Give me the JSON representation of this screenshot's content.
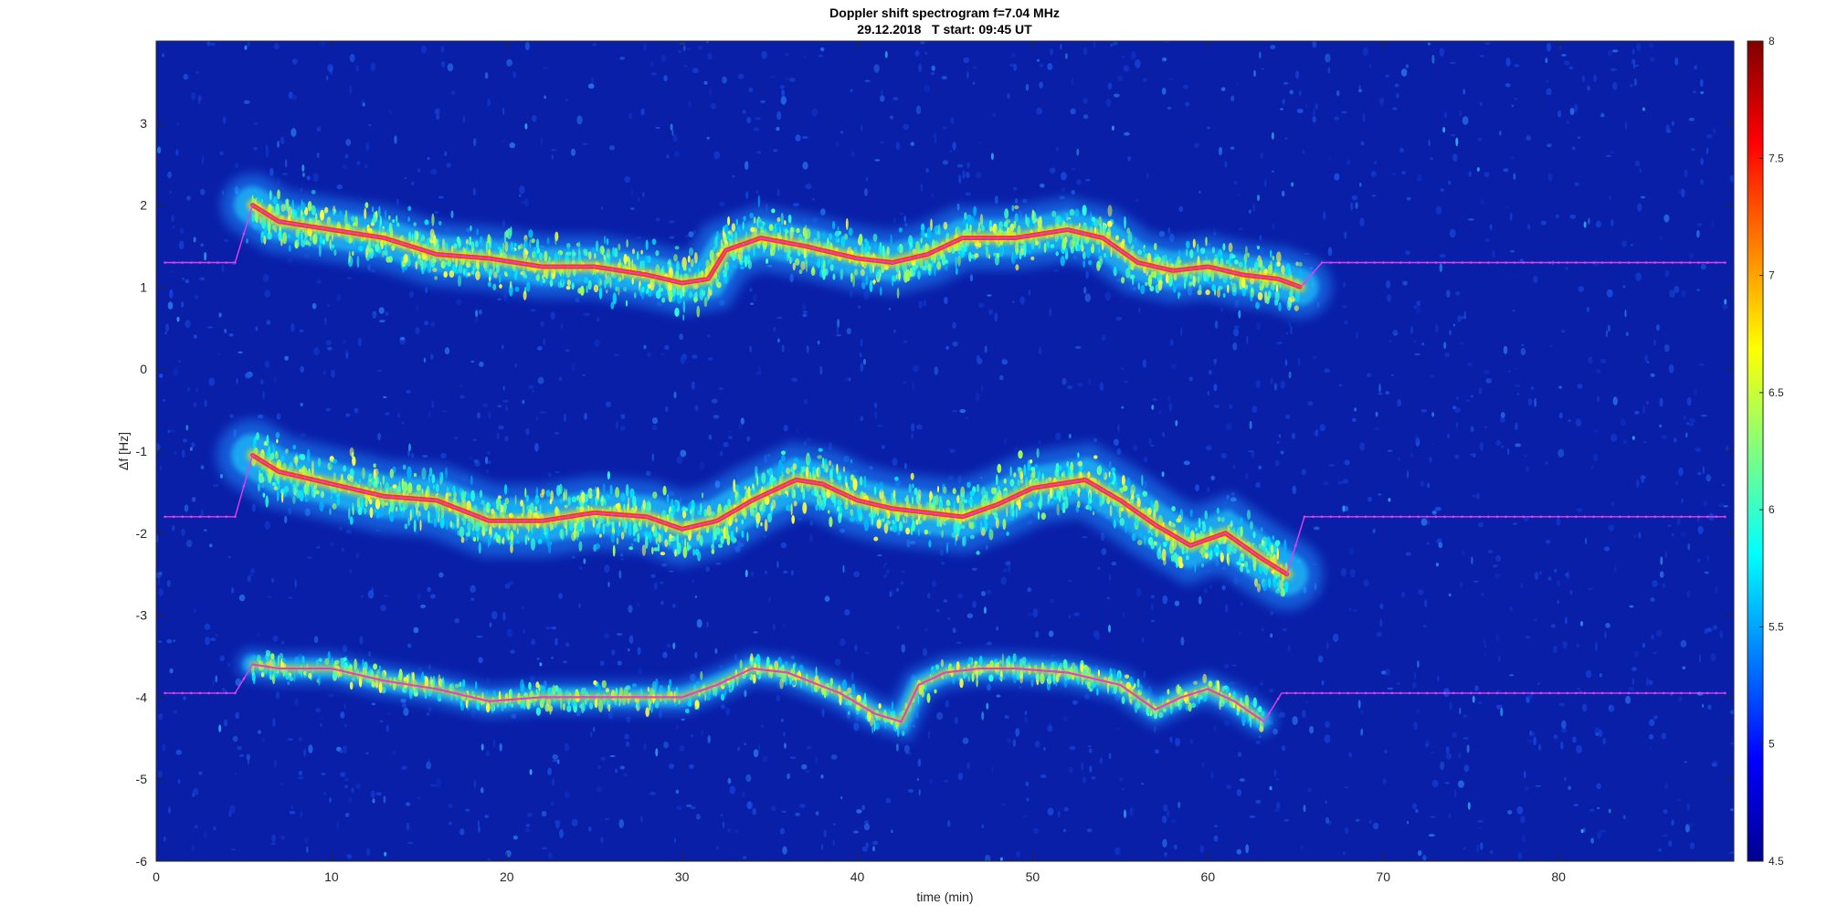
{
  "chart_data": {
    "type": "heatmap",
    "title": "Doppler shift spectrogram f=7.04 MHz",
    "subtitle": "29.12.2018   T start: 09:45 UT",
    "xlabel": "time (min)",
    "ylabel": "Δf [Hz]",
    "xlim": [
      0,
      90
    ],
    "ylim": [
      -6,
      4
    ],
    "x_ticks": [
      0,
      10,
      20,
      30,
      40,
      50,
      60,
      70,
      80
    ],
    "x_tick_labels": [
      "0",
      "10",
      "20",
      "30",
      "40",
      "50",
      "60",
      "70",
      "80"
    ],
    "y_ticks": [
      -6,
      -5,
      -4,
      -3,
      -2,
      -1,
      0,
      1,
      2,
      3
    ],
    "y_tick_labels": [
      "-6",
      "-5",
      "-4",
      "-3",
      "-2",
      "-1",
      "0",
      "1",
      "2",
      "3"
    ],
    "colormap": "jet",
    "colorbar": {
      "range": [
        4.5,
        8
      ],
      "ticks": [
        4.5,
        5,
        5.5,
        6,
        6.5,
        7,
        7.5,
        8
      ],
      "tick_labels": [
        "4.5",
        "5",
        "5.5",
        "6",
        "6.5",
        "7",
        "7.5",
        "8"
      ]
    },
    "background_color": "#0a1fa8",
    "trace_color": "#e040f0",
    "series": [
      {
        "x": [
          0.5,
          4.5,
          5.5,
          7,
          10,
          13,
          16,
          19,
          22,
          25,
          28,
          30,
          31.5,
          32.5,
          34.5,
          37,
          40,
          42,
          44,
          46,
          49,
          52,
          54,
          56,
          58,
          60,
          62,
          64,
          65.3,
          66.5,
          89.5
        ],
        "y": [
          1.3,
          1.3,
          2.0,
          1.8,
          1.7,
          1.6,
          1.4,
          1.35,
          1.25,
          1.25,
          1.15,
          1.05,
          1.1,
          1.45,
          1.6,
          1.5,
          1.35,
          1.3,
          1.4,
          1.6,
          1.6,
          1.7,
          1.6,
          1.3,
          1.2,
          1.25,
          1.15,
          1.1,
          1.0,
          1.3,
          1.3
        ],
        "core_from": 5.5,
        "core_to": 65.3,
        "spread": 0.35
      },
      {
        "x": [
          0.5,
          4.5,
          5.5,
          7,
          10,
          13,
          16,
          19,
          22,
          25,
          28,
          30,
          32,
          34,
          36.5,
          38,
          40,
          42,
          44,
          46,
          48,
          50,
          53,
          55,
          57,
          59,
          61,
          63,
          64.5,
          65.5,
          89.5
        ],
        "y": [
          -1.8,
          -1.8,
          -1.05,
          -1.25,
          -1.4,
          -1.55,
          -1.6,
          -1.85,
          -1.85,
          -1.75,
          -1.8,
          -1.95,
          -1.85,
          -1.6,
          -1.35,
          -1.4,
          -1.6,
          -1.7,
          -1.75,
          -1.8,
          -1.65,
          -1.45,
          -1.35,
          -1.6,
          -1.9,
          -2.15,
          -2.0,
          -2.3,
          -2.5,
          -1.8,
          -1.8
        ],
        "core_from": 5.5,
        "core_to": 64.5,
        "spread": 0.4
      },
      {
        "x": [
          0.5,
          4.5,
          5.5,
          7,
          10,
          13,
          16,
          19,
          22,
          25,
          28,
          30,
          32,
          34,
          36,
          39,
          41,
          42.5,
          43.5,
          45,
          47,
          49,
          52,
          55,
          57,
          58.5,
          60,
          61.5,
          63.2,
          64.2,
          89.5
        ],
        "y": [
          -3.95,
          -3.95,
          -3.6,
          -3.65,
          -3.65,
          -3.8,
          -3.9,
          -4.05,
          -4.0,
          -4.0,
          -4.0,
          -4.0,
          -3.85,
          -3.65,
          -3.7,
          -3.95,
          -4.2,
          -4.3,
          -3.85,
          -3.7,
          -3.65,
          -3.65,
          -3.7,
          -3.85,
          -4.15,
          -4.0,
          -3.9,
          -4.05,
          -4.3,
          -3.95,
          -3.95
        ],
        "core_from": 5.5,
        "core_to": 63.2,
        "spread": 0.18
      }
    ]
  }
}
